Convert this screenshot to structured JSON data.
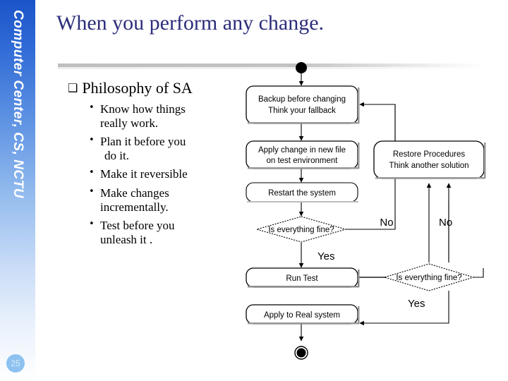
{
  "sidebar": {
    "vertical_text": "Computer Center, CS, NCTU",
    "page_number": "25"
  },
  "slide": {
    "title": "When you perform any change.",
    "title_color": "#2b2d7a"
  },
  "content": {
    "heading_marker": "❑",
    "heading": "Philosophy of SA",
    "bullet_marker": "•",
    "bullets": [
      {
        "line1": "Know how things",
        "line2": "really work."
      },
      {
        "line1": "Plan it before you",
        "line2": " do it."
      },
      {
        "line1": "Make it reversible",
        "line2": ""
      },
      {
        "line1": "Make changes",
        "line2": "incrementally."
      },
      {
        "line1": "Test before you",
        "line2": "unleash it ."
      }
    ]
  },
  "flowchart": {
    "nodes": {
      "start": "start-node",
      "end": "end-node",
      "backup_l1": "Backup before changing",
      "backup_l2": "Think your fallback",
      "apply_l1": "Apply change in new file",
      "apply_l2": "on test environment",
      "restart": "Restart the system",
      "decision1": "Is everything fine?",
      "run_test": "Run Test",
      "decision2": "Is everything fine?",
      "apply_real": "Apply to Real system",
      "restore_l1": "Restore Procedures",
      "restore_l2": "Think another solution"
    },
    "edge_labels": {
      "no1": "No",
      "no2": "No",
      "yes1": "Yes",
      "yes2": "Yes"
    }
  }
}
